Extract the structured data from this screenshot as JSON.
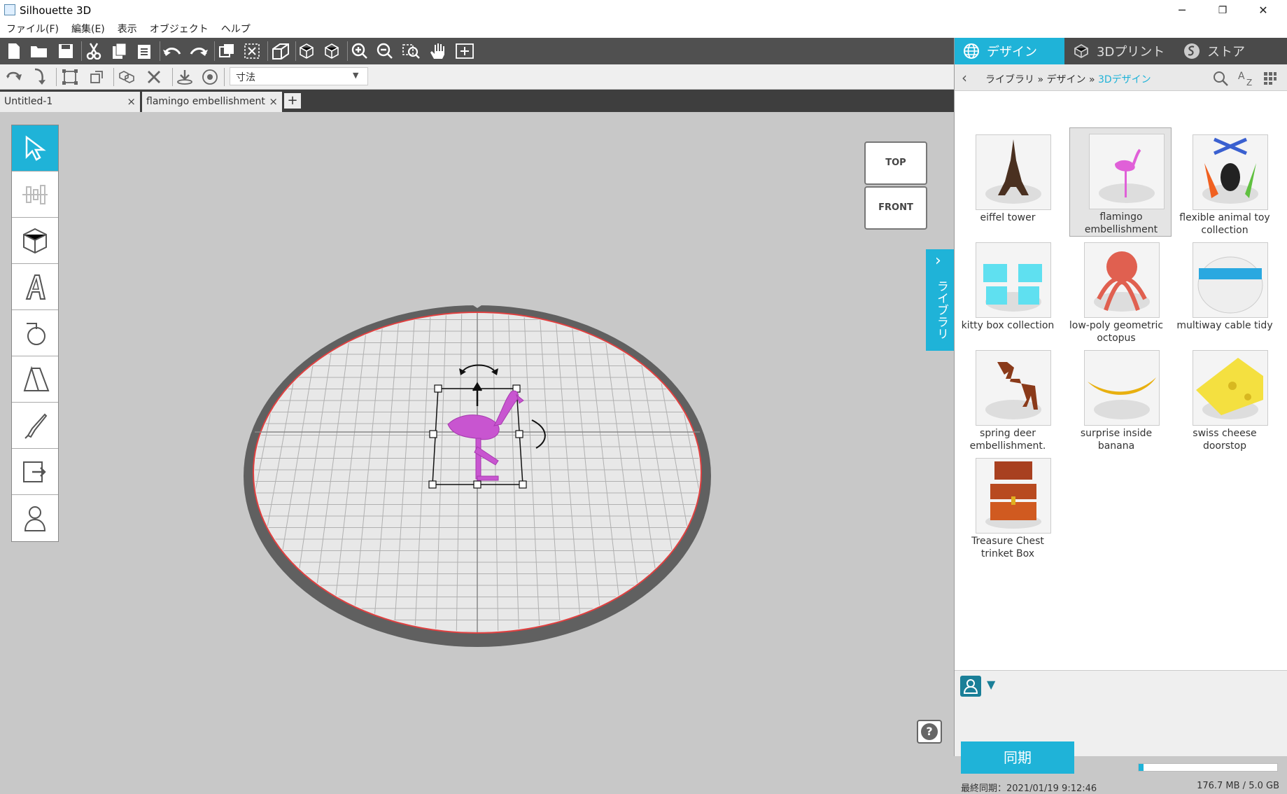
{
  "window": {
    "title": "Silhouette 3D",
    "minimize": "─",
    "restore": "❐",
    "close": "✕"
  },
  "menu": [
    "ファイル(F)",
    "編集(E)",
    "表示",
    "オブジェクト",
    "ヘルプ"
  ],
  "toolbar2": {
    "dimension_select": "寸法"
  },
  "tabs": [
    {
      "label": "Untitled-1",
      "close": "×"
    },
    {
      "label": "flamingo embellishment",
      "close": "×"
    }
  ],
  "tab_add": "+",
  "view_cube": {
    "top": "TOP",
    "front": "FRONT"
  },
  "library_side_tab": {
    "label": "ライブラリ",
    "chevron": "›"
  },
  "help": "?",
  "panel": {
    "tabs": [
      {
        "label": "デザイン",
        "icon": "globe-icon"
      },
      {
        "label": "3Dプリント",
        "icon": "printer-3d-icon"
      },
      {
        "label": "ストア",
        "icon": "store-icon"
      }
    ],
    "breadcrumb": [
      "ライブラリ",
      "デザイン",
      "3Dデザイン"
    ],
    "breadcrumb_sep": "»",
    "items": [
      {
        "name": "eiffel tower"
      },
      {
        "name": "flamingo embellishment"
      },
      {
        "name": "flexible animal toy collection"
      },
      {
        "name": "kitty box collection"
      },
      {
        "name": "low-poly geometric octopus"
      },
      {
        "name": "multiway cable tidy"
      },
      {
        "name": "spring deer embellishment."
      },
      {
        "name": "surprise inside banana"
      },
      {
        "name": "swiss cheese doorstop"
      },
      {
        "name": "Treasure Chest trinket Box"
      }
    ],
    "sync_label": "同期",
    "last_sync": "最終同期：2021/01/19 9:12:46",
    "storage": "176.7 MB / 5.0 GB",
    "storage_fraction": 0.035,
    "accent_color": "#1fb3d8"
  }
}
